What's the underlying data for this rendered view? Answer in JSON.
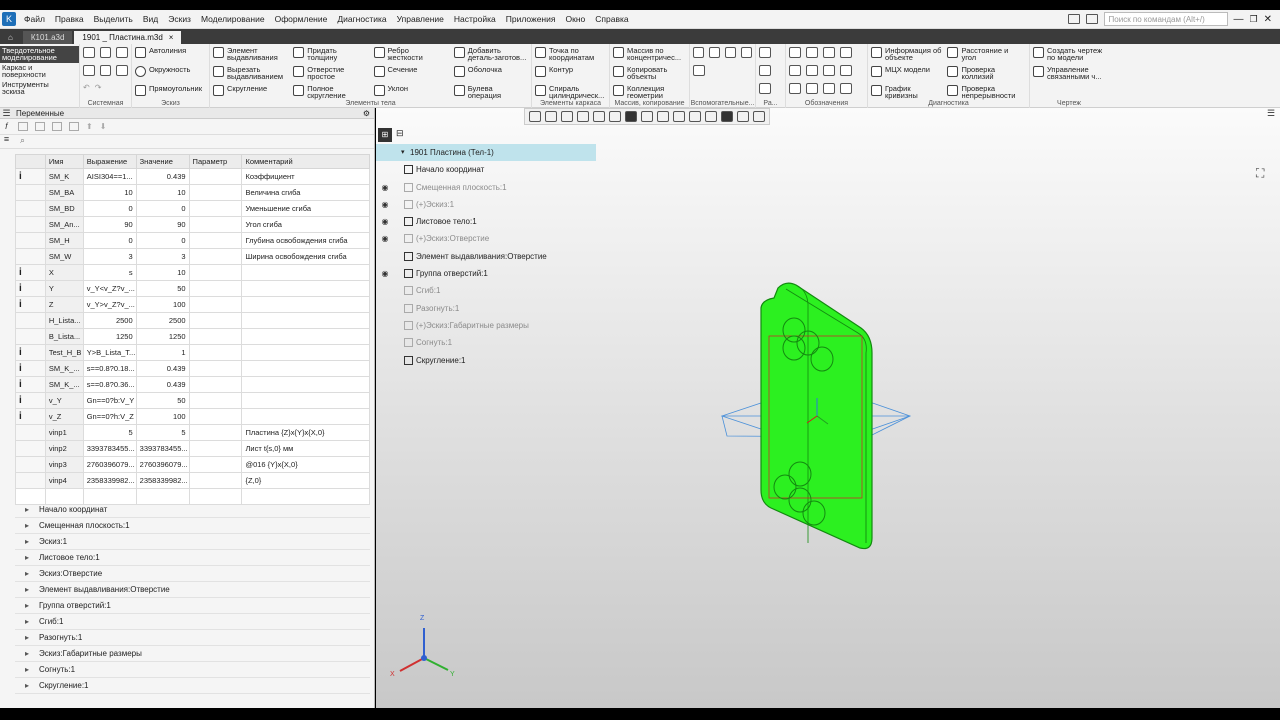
{
  "menu": {
    "items": [
      "Файл",
      "Правка",
      "Выделить",
      "Вид",
      "Эскиз",
      "Моделирование",
      "Оформление",
      "Диагностика",
      "Управление",
      "Настройка",
      "Приложения",
      "Окно",
      "Справка"
    ],
    "search_placeholder": "Поиск по командам (Alt+/)"
  },
  "tabs": [
    {
      "label": "К101.a3d"
    },
    {
      "label": "1901 _ Пластина.m3d",
      "close": "×"
    }
  ],
  "ribbon": {
    "side_items": [
      "Твердотельное\nмоделирование",
      "Каркас и\nповерхности",
      "Инструменты\nэскиза"
    ],
    "groups": {
      "system": "Системная",
      "sketch": "Эскиз",
      "body": "Элементы тела",
      "frame": "Элементы каркаса",
      "array": "Массив, копирование",
      "aux": "Вспомогательные...",
      "ra": "Ра...",
      "notation": "Обозначения",
      "diag": "Диагностика",
      "drawing": "Чертеж"
    },
    "sketch_btns": [
      "Автолиния",
      "Окружность",
      "Прямоугольник"
    ],
    "body_col1": [
      "Элемент\nвыдавливания",
      "Вырезать\nвыдавливанием",
      "Скругление"
    ],
    "body_col2": [
      "Придать\nтолщину",
      "Отверстие\nпростое",
      "Полное\nскругление"
    ],
    "body_col3": [
      "Ребро\nжесткости",
      "Сечение",
      "Уклон"
    ],
    "body_col4": [
      "Добавить\nдеталь-заготов...",
      "Оболочка",
      "Булева\nоперация"
    ],
    "frame_col": [
      "Точка по\nкоординатам",
      "Контур",
      "Спираль\nцилиндрическ..."
    ],
    "array_col": [
      "Массив по\nконцентричес...",
      "Копировать\nобъекты",
      "Коллекция\nгеометрии"
    ],
    "diag_col1": [
      "Информация об\nобъекте",
      "МЦХ модели",
      "График\nкривизны"
    ],
    "diag_col2": [
      "Расстояние и\nугол",
      "Проверка\nколлизий",
      "Проверка\nнепрерывности"
    ],
    "drawing_col": [
      "Создать чертеж\nпо модели",
      "Управление\nсвязанными ч..."
    ]
  },
  "variables_panel": {
    "title": "Переменные",
    "search_icon": "⌕",
    "columns": [
      "Имя",
      "Выражение",
      "Значение",
      "Параметр",
      "Комментарий"
    ],
    "rows": [
      {
        "mark": "i",
        "name": "SM_K",
        "expr": "AISI304==1...",
        "value": "0.439",
        "param": "",
        "comment": "Коэффициент"
      },
      {
        "mark": "",
        "name": "SM_BA",
        "expr": "10",
        "value": "10",
        "param": "",
        "comment": "Величина сгиба"
      },
      {
        "mark": "",
        "name": "SM_BD",
        "expr": "0",
        "value": "0",
        "param": "",
        "comment": "Уменьшение сгиба"
      },
      {
        "mark": "",
        "name": "SM_An...",
        "expr": "90",
        "value": "90",
        "param": "",
        "comment": "Угол сгиба"
      },
      {
        "mark": "",
        "name": "SM_H",
        "expr": "0",
        "value": "0",
        "param": "",
        "comment": "Глубина освобождения сгиба"
      },
      {
        "mark": "",
        "name": "SM_W",
        "expr": "3",
        "value": "3",
        "param": "",
        "comment": "Ширина освобождения сгиба"
      },
      {
        "mark": "i",
        "name": "X",
        "expr": "s",
        "value": "10",
        "param": "",
        "comment": ""
      },
      {
        "mark": "i",
        "name": "Y",
        "expr": "v_Y<v_Z?v_...",
        "value": "50",
        "param": "",
        "comment": ""
      },
      {
        "mark": "i",
        "name": "Z",
        "expr": "v_Y>v_Z?v_...",
        "value": "100",
        "param": "",
        "comment": ""
      },
      {
        "mark": "",
        "name": "H_Lista...",
        "expr": "2500",
        "value": "2500",
        "param": "",
        "comment": ""
      },
      {
        "mark": "",
        "name": "B_Lista...",
        "expr": "1250",
        "value": "1250",
        "param": "",
        "comment": ""
      },
      {
        "mark": "i",
        "name": "Test_H_B",
        "expr": "Y>B_Lista_T...",
        "value": "1",
        "param": "",
        "comment": ""
      },
      {
        "mark": "i",
        "name": "SM_K_...",
        "expr": "s==0.8?0.18...",
        "value": "0.439",
        "param": "",
        "comment": ""
      },
      {
        "mark": "i",
        "name": "SM_K_...",
        "expr": "s==0.8?0.36...",
        "value": "0.439",
        "param": "",
        "comment": ""
      },
      {
        "mark": "i",
        "name": "v_Y",
        "expr": "Gn==0?b:V_Y",
        "value": "50",
        "param": "",
        "comment": ""
      },
      {
        "mark": "i",
        "name": "v_Z",
        "expr": "Gn==0?h:V_Z",
        "value": "100",
        "param": "",
        "comment": ""
      },
      {
        "mark": "",
        "name": "vinp1",
        "expr": "5",
        "value": "5",
        "param": "",
        "comment": "Пластина {Z}x{Y}x{X,0}"
      },
      {
        "mark": "",
        "name": "vinp2",
        "expr": "3393783455...",
        "value": "3393783455...",
        "param": "",
        "comment": "Лист t{s,0} мм"
      },
      {
        "mark": "",
        "name": "vinp3",
        "expr": "2760396079...",
        "value": "2760396079...",
        "param": "",
        "comment": "@016 {Y}x{X,0}"
      },
      {
        "mark": "",
        "name": "vinp4",
        "expr": "2358339982...",
        "value": "2358339982...",
        "param": "",
        "comment": "{Z,0}"
      }
    ],
    "tree": [
      "Начало координат",
      "Смещенная плоскость:1",
      "Эскиз:1",
      "Листовое тело:1",
      "Эскиз:Отверстие",
      "Элемент выдавливания:Отверстие",
      "Группа отверстий:1",
      "Сгиб:1",
      "Разогнуть:1",
      "Эскиз:Габаритные размеры",
      "Согнуть:1",
      "Скругление:1"
    ]
  },
  "model_tree": {
    "root": "1901 Пластина (Тел-1)",
    "items": [
      {
        "label": "Начало координат",
        "dim": false,
        "eye": false
      },
      {
        "label": "Смещенная плоскость:1",
        "dim": true,
        "eye": true
      },
      {
        "label": "(+)Эскиз:1",
        "dim": true,
        "eye": true
      },
      {
        "label": "Листовое тело:1",
        "dim": false,
        "eye": true
      },
      {
        "label": "(+)Эскиз:Отверстие",
        "dim": true,
        "eye": true
      },
      {
        "label": "Элемент выдавливания:Отверстие",
        "dim": false,
        "eye": false
      },
      {
        "label": "Группа отверстий:1",
        "dim": false,
        "eye": true
      },
      {
        "label": "Сгиб:1",
        "dim": true,
        "eye": false
      },
      {
        "label": "Разогнуть:1",
        "dim": true,
        "eye": false
      },
      {
        "label": "(+)Эскиз:Габаритные размеры",
        "dim": true,
        "eye": false
      },
      {
        "label": "Согнуть:1",
        "dim": true,
        "eye": false
      },
      {
        "label": "Скругление:1",
        "dim": false,
        "eye": false
      }
    ]
  },
  "axes": {
    "x": "X",
    "y": "Y",
    "z": "Z"
  },
  "colors": {
    "part_green": "#2cf020",
    "accent_blue": "#1e6fb8",
    "selection": "#bfe3ec"
  }
}
